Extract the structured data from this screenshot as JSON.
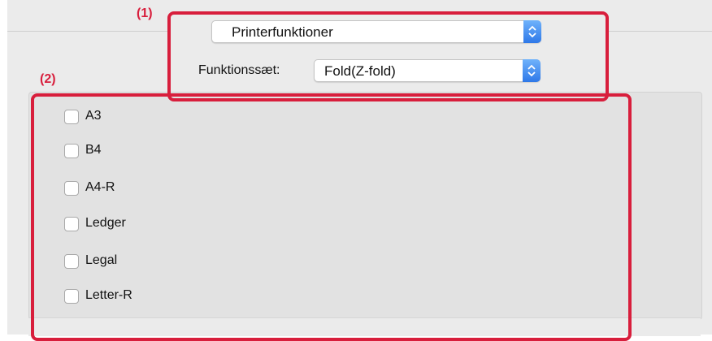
{
  "callouts": {
    "one": "(1)",
    "two": "(2)"
  },
  "panel_popup": {
    "value": "Printerfunktioner",
    "icon": "popup-stepper-icon"
  },
  "feature_set": {
    "label": "Funktionssæt:",
    "value": "Fold(Z-fold)",
    "icon": "popup-stepper-icon"
  },
  "paper_sizes": [
    {
      "label": "A3",
      "checked": false
    },
    {
      "label": "B4",
      "checked": false
    },
    {
      "label": "A4-R",
      "checked": false
    },
    {
      "label": "Ledger",
      "checked": false
    },
    {
      "label": "Legal",
      "checked": false
    },
    {
      "label": "Letter-R",
      "checked": false
    }
  ],
  "colors": {
    "highlight": "#d81e3c",
    "stepper": "#2e78e8"
  }
}
